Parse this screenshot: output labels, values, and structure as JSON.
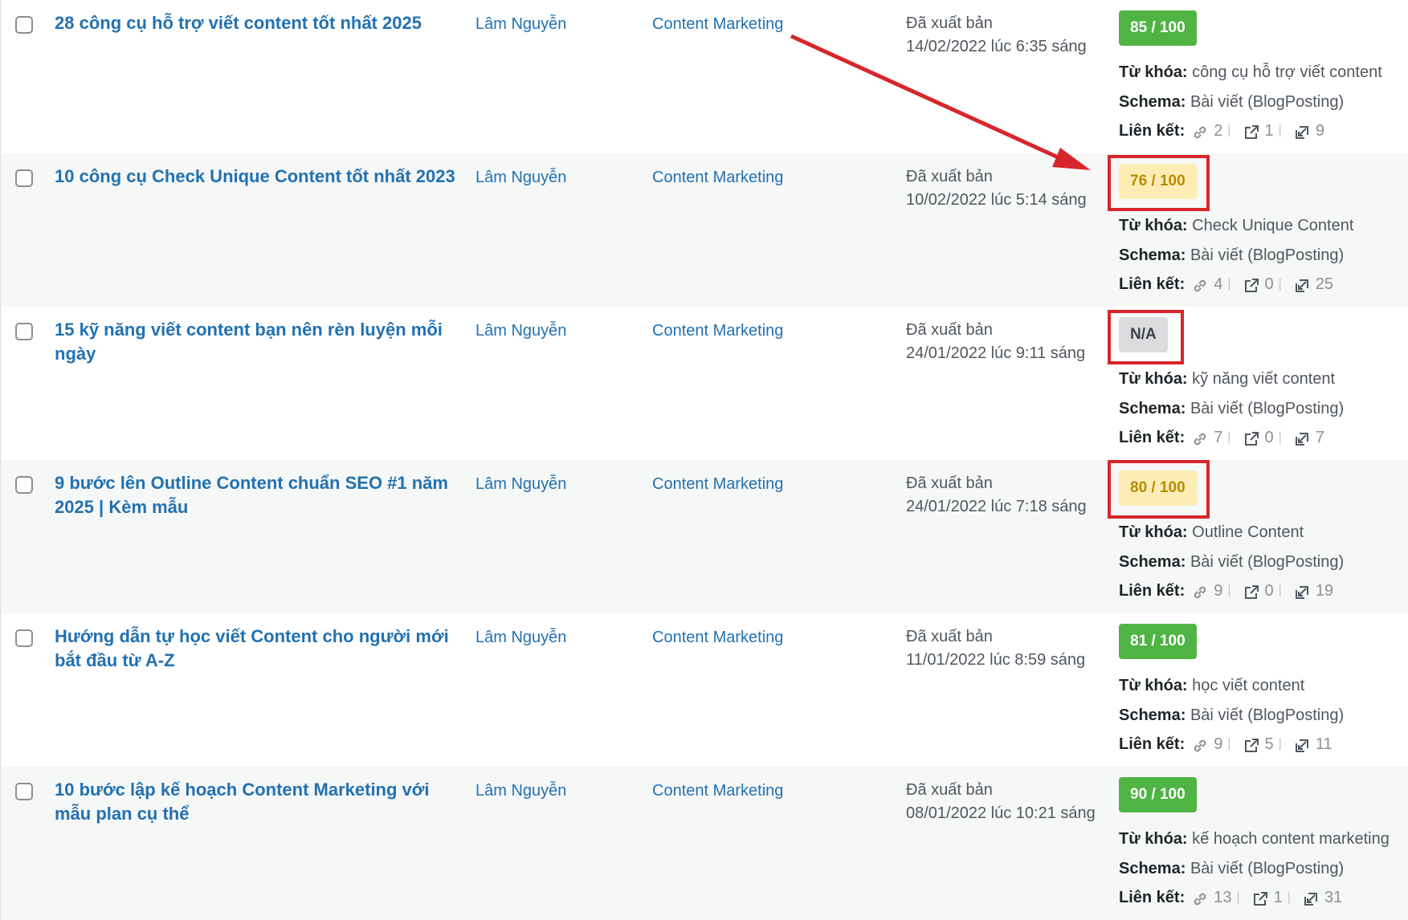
{
  "labels": {
    "keyword": "Từ khóa:",
    "schema": "Schema:",
    "links": "Liên kết:"
  },
  "colors": {
    "link": "#2271b1",
    "score_good": "#4fb443",
    "score_ok": "#fdedb5",
    "score_na": "#dcdcde",
    "highlight": "#d7262b"
  },
  "rows": [
    {
      "title": "28 công cụ hỗ trợ viết content tốt nhất 2025",
      "author": "Lâm Nguyễn",
      "category": "Content Marketing",
      "status": "Đã xuất bản",
      "date": "14/02/2022 lúc 6:35 sáng",
      "score": "85 / 100",
      "score_level": "good",
      "keyword": "công cụ hỗ trợ viết content",
      "schema": "Bài viết (BlogPosting)",
      "links_internal": "2",
      "links_external": "1",
      "links_incoming": "9"
    },
    {
      "title": "10 công cụ Check Unique Content tốt nhất 2023",
      "author": "Lâm Nguyễn",
      "category": "Content Marketing",
      "status": "Đã xuất bản",
      "date": "10/02/2022 lúc 5:14 sáng",
      "score": "76 / 100",
      "score_level": "ok",
      "keyword": "Check Unique Content",
      "schema": "Bài viết (BlogPosting)",
      "links_internal": "4",
      "links_external": "0",
      "links_incoming": "25"
    },
    {
      "title": "15 kỹ năng viết content bạn nên rèn luyện mỗi ngày",
      "author": "Lâm Nguyễn",
      "category": "Content Marketing",
      "status": "Đã xuất bản",
      "date": "24/01/2022 lúc 9:11 sáng",
      "score": "N/A",
      "score_level": "na",
      "keyword": "kỹ năng viết content",
      "schema": "Bài viết (BlogPosting)",
      "links_internal": "7",
      "links_external": "0",
      "links_incoming": "7"
    },
    {
      "title": "9 bước lên Outline Content chuẩn SEO #1 năm 2025 | Kèm mẫu",
      "author": "Lâm Nguyễn",
      "category": "Content Marketing",
      "status": "Đã xuất bản",
      "date": "24/01/2022 lúc 7:18 sáng",
      "score": "80 / 100",
      "score_level": "ok",
      "keyword": "Outline Content",
      "schema": "Bài viết (BlogPosting)",
      "links_internal": "9",
      "links_external": "0",
      "links_incoming": "19"
    },
    {
      "title": "Hướng dẫn tự học viết Content cho người mới bắt đầu từ A-Z",
      "author": "Lâm Nguyễn",
      "category": "Content Marketing",
      "status": "Đã xuất bản",
      "date": "11/01/2022 lúc 8:59 sáng",
      "score": "81 / 100",
      "score_level": "good",
      "keyword": "học viết content",
      "schema": "Bài viết (BlogPosting)",
      "links_internal": "9",
      "links_external": "5",
      "links_incoming": "11"
    },
    {
      "title": "10 bước lập kế hoạch Content Marketing với mẫu plan cụ thể",
      "author": "Lâm Nguyễn",
      "category": "Content Marketing",
      "status": "Đã xuất bản",
      "date": "08/01/2022 lúc 10:21 sáng",
      "score": "90 / 100",
      "score_level": "good",
      "keyword": "kế hoạch content marketing",
      "schema": "Bài viết (BlogPosting)",
      "links_internal": "13",
      "links_external": "1",
      "links_incoming": "31"
    }
  ]
}
